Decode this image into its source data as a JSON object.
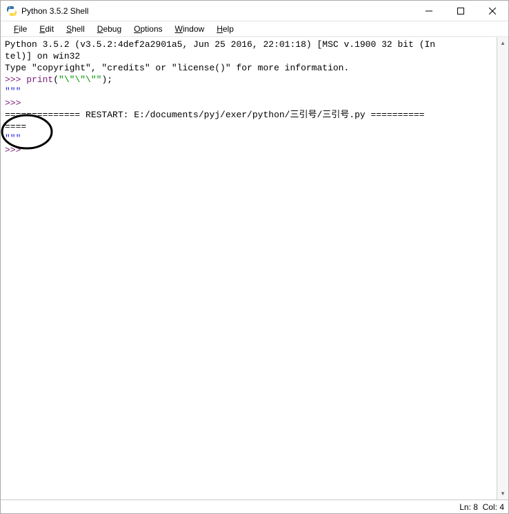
{
  "title": "Python 3.5.2 Shell",
  "window_controls": {
    "min": "—",
    "max": "▢",
    "close": "✕"
  },
  "menu": {
    "file": {
      "ul": "F",
      "rest": "ile"
    },
    "edit": {
      "ul": "E",
      "rest": "dit"
    },
    "shell": {
      "ul": "S",
      "rest": "hell"
    },
    "debug": {
      "ul": "D",
      "rest": "ebug"
    },
    "options": {
      "ul": "O",
      "rest": "ptions"
    },
    "window": {
      "ul": "W",
      "rest": "indow"
    },
    "help": {
      "ul": "H",
      "rest": "elp"
    }
  },
  "shell": {
    "banner1": "Python 3.5.2 (v3.5.2:4def2a2901a5, Jun 25 2016, 22:01:18) [MSC v.1900 32 bit (In",
    "banner2": "tel)] on win32",
    "banner3": "Type \"copyright\", \"credits\" or \"license()\" for more information.",
    "p1": ">>> ",
    "call_kw": "print",
    "call_paren_open": "(",
    "call_str": "\"\\\"\\\"\\\"\"",
    "call_paren_close": ");",
    "out1": "\"\"\"",
    "p2": ">>> ",
    "restart1": "============== RESTART: E:/documents/pyj/exer/python/三引号/三引号.py ==========",
    "restart2": "====",
    "out2": "\"\"\"",
    "p3": ">>> "
  },
  "status": {
    "ln_label": "Ln:",
    "ln": "8",
    "col_label": "Col:",
    "col": "4"
  }
}
